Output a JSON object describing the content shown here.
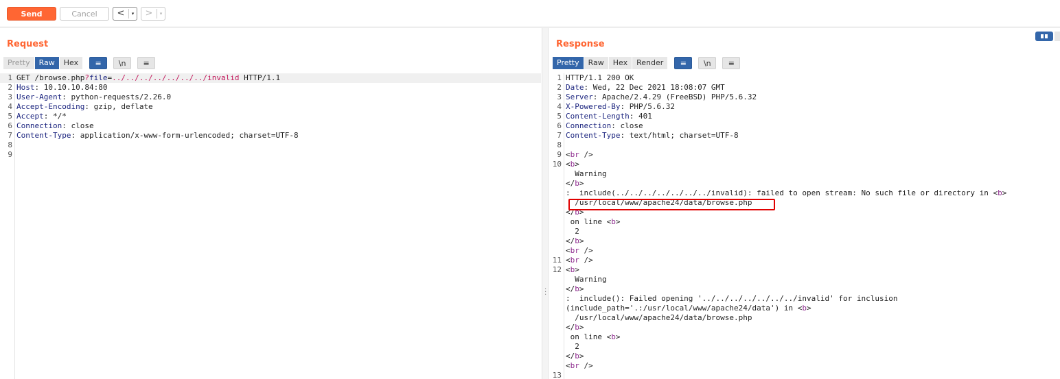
{
  "toolbar": {
    "send_label": "Send",
    "cancel_label": "Cancel",
    "back_arrow": "<",
    "forward_arrow": ">",
    "caret": "▾",
    "colors": {
      "accent": "#ff6633",
      "tab_active": "#3366aa"
    }
  },
  "request": {
    "title": "Request",
    "tabs": [
      "Pretty",
      "Raw",
      "Hex"
    ],
    "active_tab": "Raw",
    "wrap_icon": "≡",
    "newline_label": "\\n",
    "menu_icon": "≡",
    "lines": [
      {
        "n": "1",
        "parts": [
          [
            "v",
            "GET /browse.php"
          ],
          [
            "p",
            "?"
          ],
          [
            "k",
            "file"
          ],
          [
            "v",
            "="
          ],
          [
            "p",
            "../../../../../../../invalid"
          ],
          [
            "v",
            " HTTP/1.1"
          ]
        ]
      },
      {
        "n": "2",
        "parts": [
          [
            "k",
            "Host"
          ],
          [
            "v",
            ": 10.10.10.84:80"
          ]
        ]
      },
      {
        "n": "3",
        "parts": [
          [
            "k",
            "User-Agent"
          ],
          [
            "v",
            ": python-requests/2.26.0"
          ]
        ]
      },
      {
        "n": "4",
        "parts": [
          [
            "k",
            "Accept-Encoding"
          ],
          [
            "v",
            ": gzip, deflate"
          ]
        ]
      },
      {
        "n": "5",
        "parts": [
          [
            "k",
            "Accept"
          ],
          [
            "v",
            ": */*"
          ]
        ]
      },
      {
        "n": "6",
        "parts": [
          [
            "k",
            "Connection"
          ],
          [
            "v",
            ": close"
          ]
        ]
      },
      {
        "n": "7",
        "parts": [
          [
            "k",
            "Content-Type"
          ],
          [
            "v",
            ": application/x-www-form-urlencoded; charset=UTF-8"
          ]
        ]
      },
      {
        "n": "8",
        "parts": []
      },
      {
        "n": "9",
        "parts": []
      }
    ]
  },
  "response": {
    "title": "Response",
    "tabs": [
      "Pretty",
      "Raw",
      "Hex",
      "Render"
    ],
    "active_tab": "Pretty",
    "wrap_icon": "≡",
    "newline_label": "\\n",
    "menu_icon": "≡",
    "lines": [
      {
        "n": "1",
        "parts": [
          [
            "v",
            "HTTP/1.1 200 OK"
          ]
        ]
      },
      {
        "n": "2",
        "parts": [
          [
            "k",
            "Date"
          ],
          [
            "v",
            ": Wed, 22 Dec 2021 18:08:07 GMT"
          ]
        ]
      },
      {
        "n": "3",
        "parts": [
          [
            "k",
            "Server"
          ],
          [
            "v",
            ": Apache/2.4.29 (FreeBSD) PHP/5.6.32"
          ]
        ]
      },
      {
        "n": "4",
        "parts": [
          [
            "k",
            "X-Powered-By"
          ],
          [
            "v",
            ": PHP/5.6.32"
          ]
        ]
      },
      {
        "n": "5",
        "parts": [
          [
            "k",
            "Content-Length"
          ],
          [
            "v",
            ": 401"
          ]
        ]
      },
      {
        "n": "6",
        "parts": [
          [
            "k",
            "Connection"
          ],
          [
            "v",
            ": close"
          ]
        ]
      },
      {
        "n": "7",
        "parts": [
          [
            "k",
            "Content-Type"
          ],
          [
            "v",
            ": text/html; charset=UTF-8"
          ]
        ]
      },
      {
        "n": "8",
        "parts": []
      },
      {
        "n": "9",
        "parts": [
          [
            "v",
            "<"
          ],
          [
            "t",
            "br"
          ],
          [
            "v",
            " />"
          ]
        ]
      },
      {
        "n": "10",
        "parts": [
          [
            "v",
            "<"
          ],
          [
            "t",
            "b"
          ],
          [
            "v",
            ">"
          ]
        ]
      },
      {
        "n": "",
        "parts": [
          [
            "v",
            "  Warning"
          ]
        ]
      },
      {
        "n": "",
        "parts": [
          [
            "v",
            "</"
          ],
          [
            "t",
            "b"
          ],
          [
            "v",
            ">"
          ]
        ]
      },
      {
        "n": "",
        "parts": [
          [
            "v",
            ":  include(../../../../../../../invalid): failed to open stream: No such file or directory in <"
          ],
          [
            "t",
            "b"
          ],
          [
            "v",
            ">"
          ]
        ]
      },
      {
        "n": "",
        "parts": [
          [
            "v",
            "  /usr/local/www/apache24/data/browse.php"
          ]
        ]
      },
      {
        "n": "",
        "parts": [
          [
            "v",
            "</"
          ],
          [
            "t",
            "b"
          ],
          [
            "v",
            ">"
          ]
        ]
      },
      {
        "n": "",
        "parts": [
          [
            "v",
            " on line <"
          ],
          [
            "t",
            "b"
          ],
          [
            "v",
            ">"
          ]
        ]
      },
      {
        "n": "",
        "parts": [
          [
            "v",
            "  2"
          ]
        ]
      },
      {
        "n": "",
        "parts": [
          [
            "v",
            "</"
          ],
          [
            "t",
            "b"
          ],
          [
            "v",
            ">"
          ]
        ]
      },
      {
        "n": "",
        "parts": [
          [
            "v",
            "<"
          ],
          [
            "t",
            "br"
          ],
          [
            "v",
            " />"
          ]
        ]
      },
      {
        "n": "11",
        "parts": [
          [
            "v",
            "<"
          ],
          [
            "t",
            "br"
          ],
          [
            "v",
            " />"
          ]
        ]
      },
      {
        "n": "12",
        "parts": [
          [
            "v",
            "<"
          ],
          [
            "t",
            "b"
          ],
          [
            "v",
            ">"
          ]
        ]
      },
      {
        "n": "",
        "parts": [
          [
            "v",
            "  Warning"
          ]
        ]
      },
      {
        "n": "",
        "parts": [
          [
            "v",
            "</"
          ],
          [
            "t",
            "b"
          ],
          [
            "v",
            ">"
          ]
        ]
      },
      {
        "n": "",
        "parts": [
          [
            "v",
            ":  include(): Failed opening '../../../../../../../invalid' for inclusion"
          ]
        ]
      },
      {
        "n": "",
        "parts": [
          [
            "v",
            "(include_path='.:/usr/local/www/apache24/data') in <"
          ],
          [
            "t",
            "b"
          ],
          [
            "v",
            ">"
          ]
        ]
      },
      {
        "n": "",
        "parts": [
          [
            "v",
            "  /usr/local/www/apache24/data/browse.php"
          ]
        ]
      },
      {
        "n": "",
        "parts": [
          [
            "v",
            "</"
          ],
          [
            "t",
            "b"
          ],
          [
            "v",
            ">"
          ]
        ]
      },
      {
        "n": "",
        "parts": [
          [
            "v",
            " on line <"
          ],
          [
            "t",
            "b"
          ],
          [
            "v",
            ">"
          ]
        ]
      },
      {
        "n": "",
        "parts": [
          [
            "v",
            "  2"
          ]
        ]
      },
      {
        "n": "",
        "parts": [
          [
            "v",
            "</"
          ],
          [
            "t",
            "b"
          ],
          [
            "v",
            ">"
          ]
        ]
      },
      {
        "n": "",
        "parts": [
          [
            "v",
            "<"
          ],
          [
            "t",
            "br"
          ],
          [
            "v",
            " />"
          ]
        ]
      },
      {
        "n": "13",
        "parts": []
      }
    ]
  }
}
